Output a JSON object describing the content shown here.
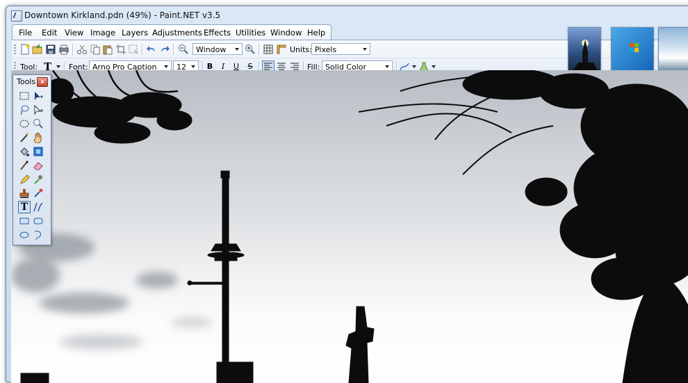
{
  "window": {
    "title": "Downtown Kirkland.pdn (49%) - Paint.NET v3.5"
  },
  "menu": [
    "File",
    "Edit",
    "View",
    "Image",
    "Layers",
    "Adjustments",
    "Effects",
    "Utilities",
    "Window",
    "Help"
  ],
  "toolbar1": {
    "zoom_value": "Window",
    "units_label": "Units:",
    "units_value": "Pixels"
  },
  "toolbar2": {
    "tool_label": "Tool:",
    "tool_glyph": "T",
    "font_label": "Font:",
    "font_value": "Arno Pro Caption",
    "size_value": "12",
    "bold": "B",
    "italic": "I",
    "underline": "U",
    "strike": "S",
    "fill_label": "Fill:",
    "fill_value": "Solid Color"
  },
  "tools_window": {
    "title": "Tools",
    "close": "x",
    "text_tool_glyph": "T"
  },
  "colors": {
    "sky_top": "#b6bcc3",
    "sky_bottom": "#ffffff",
    "chrome": "#dbe8f6",
    "silhouette": "#0c0c0c",
    "close_red": "#c4402a"
  }
}
